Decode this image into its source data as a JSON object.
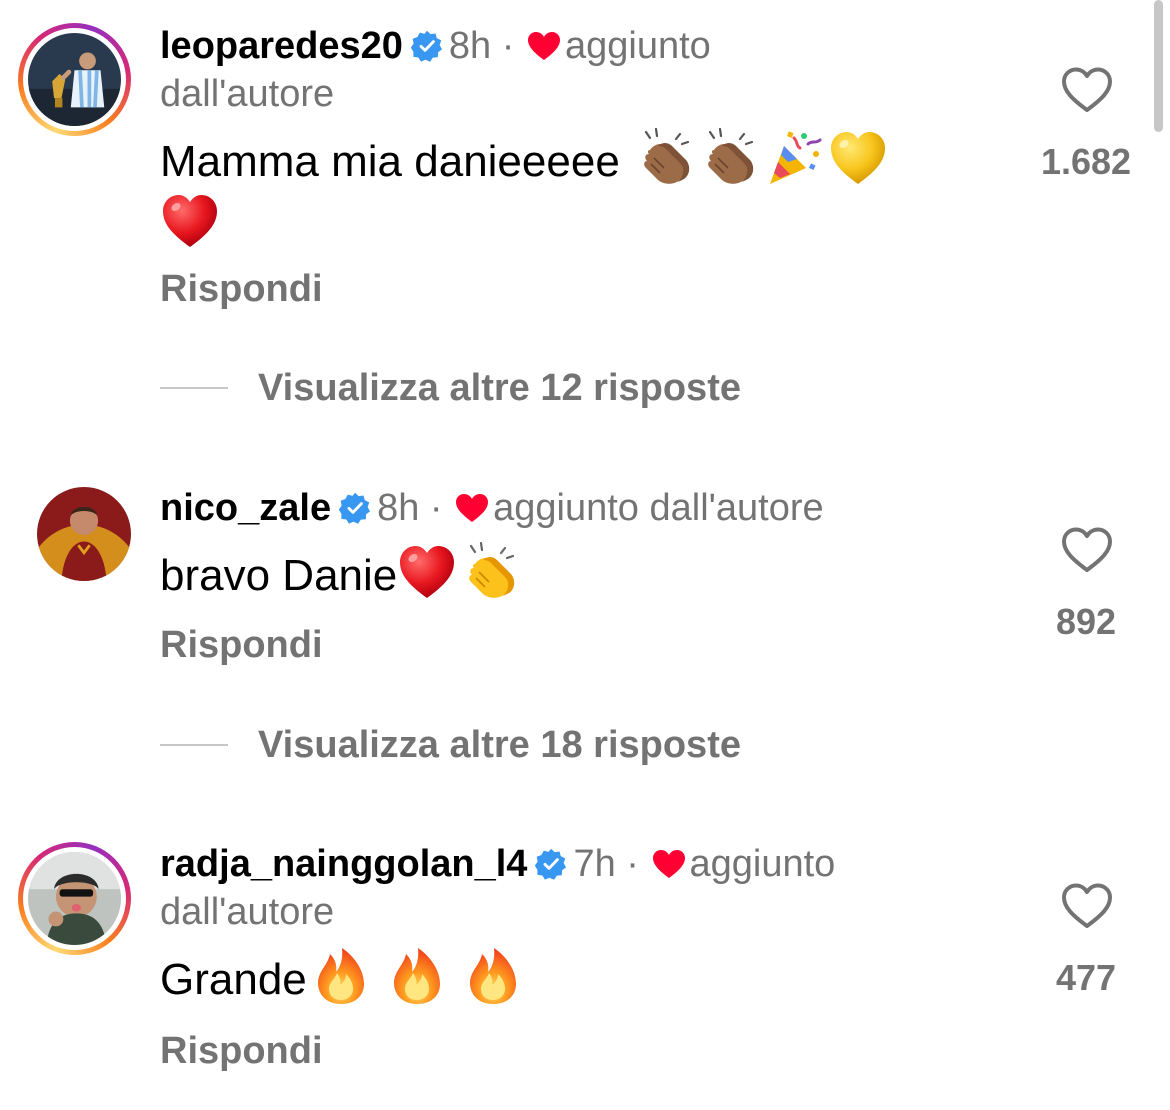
{
  "comments": [
    {
      "username": "leoparedes20",
      "time": "8h",
      "separator": "·",
      "author_like_label": "aggiunto",
      "author_like_label_2": "dall'autore",
      "text": "Mamma mia danieeeee",
      "emojis": [
        "clapping-hands-medium-dark",
        "clapping-hands-medium-dark",
        "party-popper",
        "yellow-heart",
        "red-heart"
      ],
      "like_count": "1.682",
      "reply_label": "Rispondi",
      "view_replies_label": "Visualizza altre 12 risposte"
    },
    {
      "username": "nico_zale",
      "time": "8h",
      "separator": "·",
      "author_like_label": "aggiunto dall'autore",
      "text": "bravo Danie",
      "emojis": [
        "red-heart",
        "clapping-hands-yellow"
      ],
      "like_count": "892",
      "reply_label": "Rispondi",
      "view_replies_label": "Visualizza altre 18 risposte"
    },
    {
      "username": "radja_nainggolan_l4",
      "time": "7h",
      "separator": "·",
      "author_like_label": "aggiunto",
      "author_like_label_2": "dall'autore",
      "text": "Grande",
      "emojis": [
        "fire",
        "fire",
        "fire"
      ],
      "like_count": "477",
      "reply_label": "Rispondi"
    }
  ],
  "colors": {
    "verified": "#3897f0",
    "heart_red": "#ff0033",
    "secondary_text": "#737373",
    "story_ring": [
      "#feda75",
      "#fa7e1e",
      "#d62976",
      "#962fbf"
    ]
  }
}
